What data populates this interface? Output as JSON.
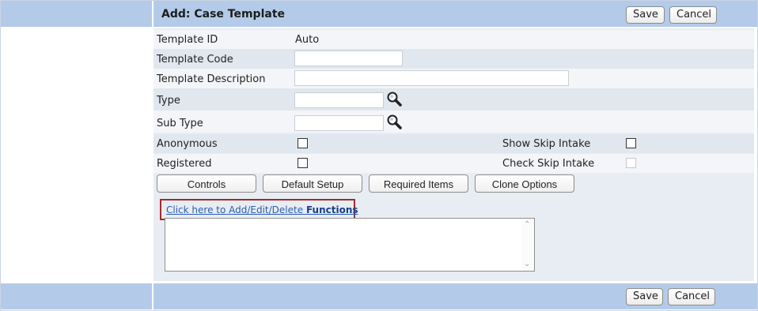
{
  "header": {
    "title": "Add: Case Template",
    "save_label": "Save",
    "cancel_label": "Cancel"
  },
  "form": {
    "template_id": {
      "label": "Template ID",
      "value": "Auto"
    },
    "template_code": {
      "label": "Template Code",
      "value": ""
    },
    "template_description": {
      "label": "Template Description",
      "value": ""
    },
    "type": {
      "label": "Type",
      "value": ""
    },
    "sub_type": {
      "label": "Sub Type",
      "value": ""
    },
    "anonymous": {
      "label": "Anonymous",
      "checked": false
    },
    "show_skip_intake": {
      "label": "Show Skip Intake",
      "checked": false
    },
    "registered": {
      "label": "Registered",
      "checked": false
    },
    "check_skip_intake": {
      "label": "Check Skip Intake",
      "checked": false,
      "disabled": true
    }
  },
  "section_buttons": [
    "Controls",
    "Default Setup",
    "Required Items",
    "Clone Options"
  ],
  "functions": {
    "link_prefix": "Click here to Add/Edit/Delete ",
    "link_bold": "Functions",
    "text": ""
  },
  "footer": {
    "save_label": "Save",
    "cancel_label": "Cancel"
  },
  "icons": {
    "lookup": "magnifier-icon",
    "scroll_up": "scroll-up-icon",
    "scroll_down": "scroll-down-icon"
  },
  "colors": {
    "header_bg": "#b3cbe8",
    "row_light": "#f3f5f8",
    "row_dark": "#e1e7ee",
    "highlight_border": "#a52a2a",
    "link": "#2a5db0"
  }
}
